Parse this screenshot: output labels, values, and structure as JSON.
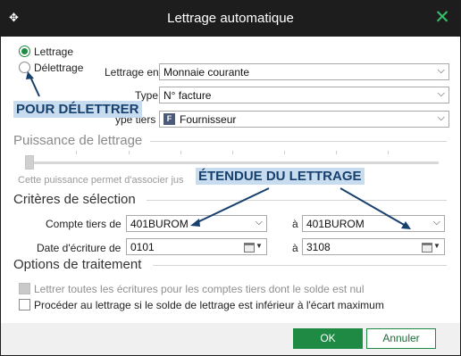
{
  "window": {
    "title": "Lettrage automatique",
    "app_icon": "move-icon",
    "close_icon": "close-icon"
  },
  "mode": {
    "lettrage_label": "Lettrage",
    "delettrage_label": "Délettrage",
    "selected": "Lettrage"
  },
  "fields": {
    "lettrage_en_label": "Lettrage en",
    "lettrage_en_value": "Monnaie courante",
    "type_label": "Type",
    "type_value": "N° facture",
    "type_tiers_label": "ype tiers",
    "type_tiers_value": "Fournisseur",
    "type_tiers_badge": "F"
  },
  "puissance": {
    "section_label": "Puissance de lettrage",
    "hint": "Cette puissance permet d'associer jus"
  },
  "criteres": {
    "section_label": "Critères de sélection",
    "compte_tiers_label": "Compte tiers de",
    "compte_tiers_from": "401BUROM",
    "to_label": "à",
    "compte_tiers_to": "401BUROM",
    "date_label": "Date d'écriture de",
    "date_from": "0101",
    "date_to": "3108"
  },
  "options": {
    "section_label": "Options de traitement",
    "opt1_label": "Lettrer toutes les écritures pour les comptes tiers dont le solde est nul",
    "opt1_checked": false,
    "opt1_disabled": true,
    "opt2_label": "Procéder au lettrage si le solde de lettrage est inférieur à l'écart maximum",
    "opt2_checked": false
  },
  "annotations": {
    "pour_delettrer": "POUR DÉLETTRER",
    "etendue": "ÉTENDUE DU LETTRAGE"
  },
  "buttons": {
    "ok": "OK",
    "cancel": "Annuler"
  },
  "colors": {
    "accent": "#1e8a44",
    "close": "#35c06a",
    "titlebar": "#1d1d1d",
    "annotation_bg": "#c8dcef",
    "annotation_text": "#17406d"
  }
}
